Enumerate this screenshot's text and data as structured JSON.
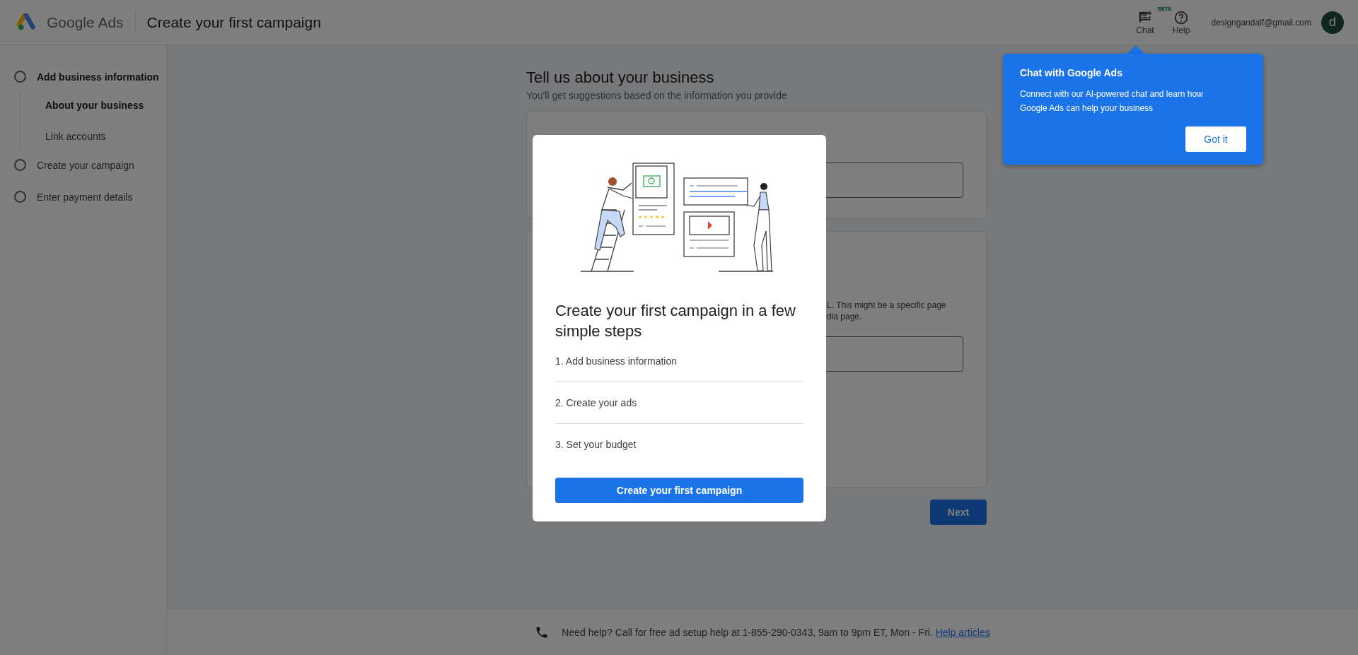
{
  "header": {
    "product": "Google Ads",
    "title": "Create your first campaign",
    "actions": [
      {
        "kind": "chat",
        "label": "Chat",
        "badge": "BETA"
      },
      {
        "kind": "help",
        "label": "Help"
      }
    ],
    "account": "designgandalf@gmail.com",
    "avatar": "d"
  },
  "sidebar": {
    "steps": [
      {
        "label": "Add business information",
        "selected": true,
        "children": [
          {
            "label": "About your business",
            "selected": true
          },
          {
            "label": "Link accounts",
            "selected": false
          }
        ]
      },
      {
        "label": "Create your campaign",
        "selected": false
      },
      {
        "label": "Enter payment details",
        "selected": false
      }
    ]
  },
  "main": {
    "heading": "Tell us about your business",
    "subheading": "You'll get suggestions based on the information you provide",
    "card_2_text_fragment": [
      "L. This might be a specific page",
      "dia page."
    ],
    "next_button": "Next"
  },
  "footer": {
    "help_text": "Need help? Call for free ad setup help at 1-855-290-0343, 9am to 9pm ET, Mon - Fri.",
    "link": "Help articles"
  },
  "dialog": {
    "title": "Create your first campaign in a few simple steps",
    "steps": [
      "1. Add business information",
      "2. Create your ads",
      "3. Set your budget"
    ],
    "button": "Create your first campaign"
  },
  "chat_tooltip": {
    "title": "Chat with Google Ads",
    "body": "Connect with our AI-powered chat and learn how Google Ads can help your business",
    "button": "Got it"
  }
}
